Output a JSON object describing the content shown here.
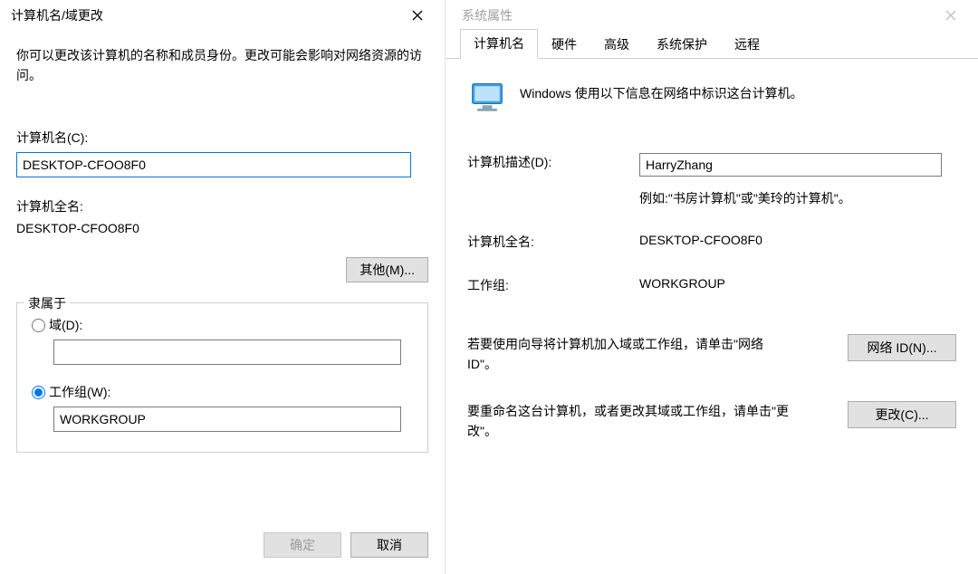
{
  "left": {
    "title": "计算机名/域更改",
    "intro": "你可以更改该计算机的名称和成员身份。更改可能会影响对网络资源的访问。",
    "computer_name_label": "计算机名(C):",
    "computer_name_value": "DESKTOP-CFOO8F0",
    "full_name_label": "计算机全名:",
    "full_name_value": "DESKTOP-CFOO8F0",
    "other_button": "其他(M)...",
    "member_legend": "隶属于",
    "domain_label": "域(D):",
    "domain_value": "",
    "workgroup_label": "工作组(W):",
    "workgroup_value": "WORKGROUP",
    "ok": "确定",
    "cancel": "取消"
  },
  "right": {
    "title": "系统属性",
    "tabs": [
      "计算机名",
      "硬件",
      "高级",
      "系统保护",
      "远程"
    ],
    "active_tab_index": 0,
    "info_text": "Windows 使用以下信息在网络中标识这台计算机。",
    "desc_label": "计算机描述(D):",
    "desc_value": "HarryZhang",
    "example_text": "例如:\"书房计算机\"或\"美玲的计算机\"。",
    "full_name_label": "计算机全名:",
    "full_name_value": "DESKTOP-CFOO8F0",
    "workgroup_label": "工作组:",
    "workgroup_value": "WORKGROUP",
    "net_id_hint": "若要使用向导将计算机加入域或工作组，请单击\"网络 ID\"。",
    "net_id_button": "网络 ID(N)...",
    "change_hint": "要重命名这台计算机，或者更改其域或工作组，请单击\"更改\"。",
    "change_button": "更改(C)..."
  }
}
